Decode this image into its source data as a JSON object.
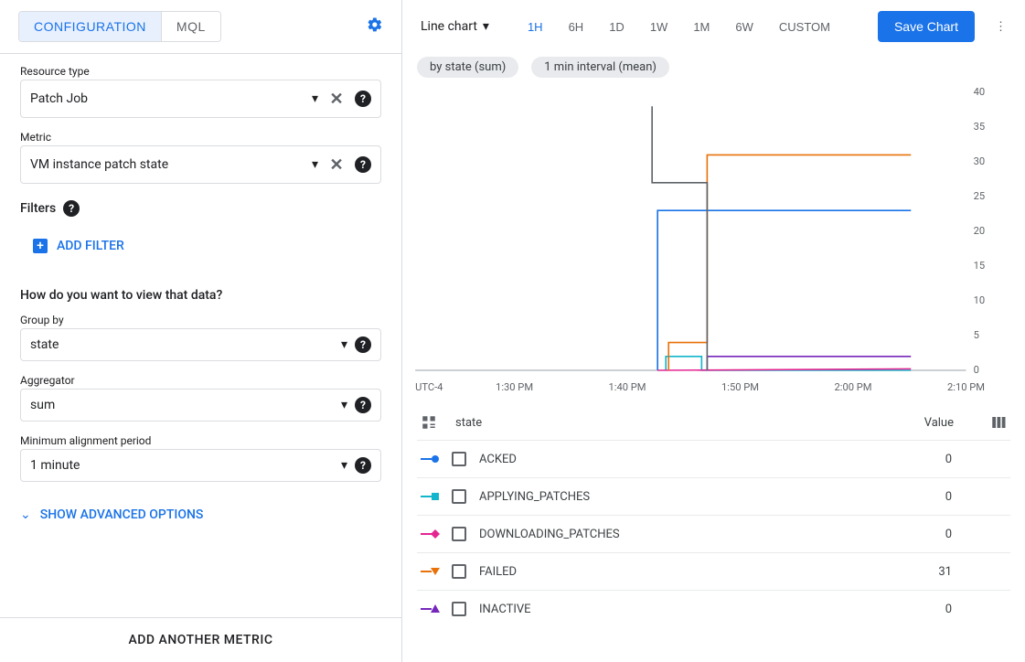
{
  "left": {
    "tabs": {
      "configuration": "CONFIGURATION",
      "mql": "MQL"
    },
    "resource_type": {
      "label": "Resource type",
      "value": "Patch Job"
    },
    "metric": {
      "label": "Metric",
      "value": "VM instance patch state"
    },
    "filters_label": "Filters",
    "add_filter": "ADD FILTER",
    "view_question": "How do you want to view that data?",
    "group_by": {
      "label": "Group by",
      "value": "state"
    },
    "aggregator": {
      "label": "Aggregator",
      "value": "sum"
    },
    "min_align": {
      "label": "Minimum alignment period",
      "value": "1 minute"
    },
    "show_advanced": "SHOW ADVANCED OPTIONS",
    "add_metric": "ADD ANOTHER METRIC"
  },
  "toolbar": {
    "chart_type": "Line chart",
    "ranges": [
      "1H",
      "6H",
      "1D",
      "1W",
      "1M",
      "6W",
      "CUSTOM"
    ],
    "active_range": "1H",
    "save": "Save Chart"
  },
  "chips": {
    "by_state": "by state (sum)",
    "interval": "1 min interval (mean)"
  },
  "legend": {
    "state_header": "state",
    "value_header": "Value",
    "rows": [
      {
        "name": "ACKED",
        "value": "0",
        "color": "#1a73e8",
        "shape": "circle"
      },
      {
        "name": "APPLYING_PATCHES",
        "value": "0",
        "color": "#12b5cb",
        "shape": "square"
      },
      {
        "name": "DOWNLOADING_PATCHES",
        "value": "0",
        "color": "#e52592",
        "shape": "diamond"
      },
      {
        "name": "FAILED",
        "value": "31",
        "color": "#e8710a",
        "shape": "down-triangle"
      },
      {
        "name": "INACTIVE",
        "value": "0",
        "color": "#7627bb",
        "shape": "up-triangle"
      }
    ]
  },
  "chart_data": {
    "type": "line",
    "timezone": "UTC-4",
    "x_ticks": [
      "1:30 PM",
      "1:40 PM",
      "1:50 PM",
      "2:00 PM",
      "2:10 PM"
    ],
    "y_ticks": [
      0,
      5,
      10,
      15,
      20,
      25,
      30,
      35,
      40
    ],
    "ylim": [
      0,
      40
    ],
    "series": [
      {
        "name": "ACKED",
        "color": "#1a73e8",
        "points": [
          [
            44,
            0
          ],
          [
            44,
            23
          ],
          [
            90,
            23
          ]
        ]
      },
      {
        "name": "APPLYING_PATCHES",
        "color": "#12b5cb",
        "points": [
          [
            45.5,
            0
          ],
          [
            45.5,
            2
          ],
          [
            52,
            2
          ],
          [
            52,
            0
          ],
          [
            90,
            0
          ]
        ]
      },
      {
        "name": "DOWNLOADING_PATCHES",
        "color": "#e52592",
        "points": [
          [
            44,
            0
          ],
          [
            90,
            0.2
          ]
        ]
      },
      {
        "name": "FAILED",
        "color": "#e8710a",
        "points": [
          [
            46,
            0
          ],
          [
            46,
            4
          ],
          [
            53,
            4
          ],
          [
            53,
            31
          ],
          [
            90,
            31
          ]
        ]
      },
      {
        "name": "INACTIVE",
        "color": "#7627bb",
        "points": [
          [
            53,
            0
          ],
          [
            53,
            2
          ],
          [
            90,
            2
          ]
        ]
      },
      {
        "name": "other",
        "color": "#5f6368",
        "points": [
          [
            43,
            38
          ],
          [
            43,
            27
          ],
          [
            53,
            27
          ],
          [
            53,
            0
          ]
        ]
      }
    ]
  }
}
